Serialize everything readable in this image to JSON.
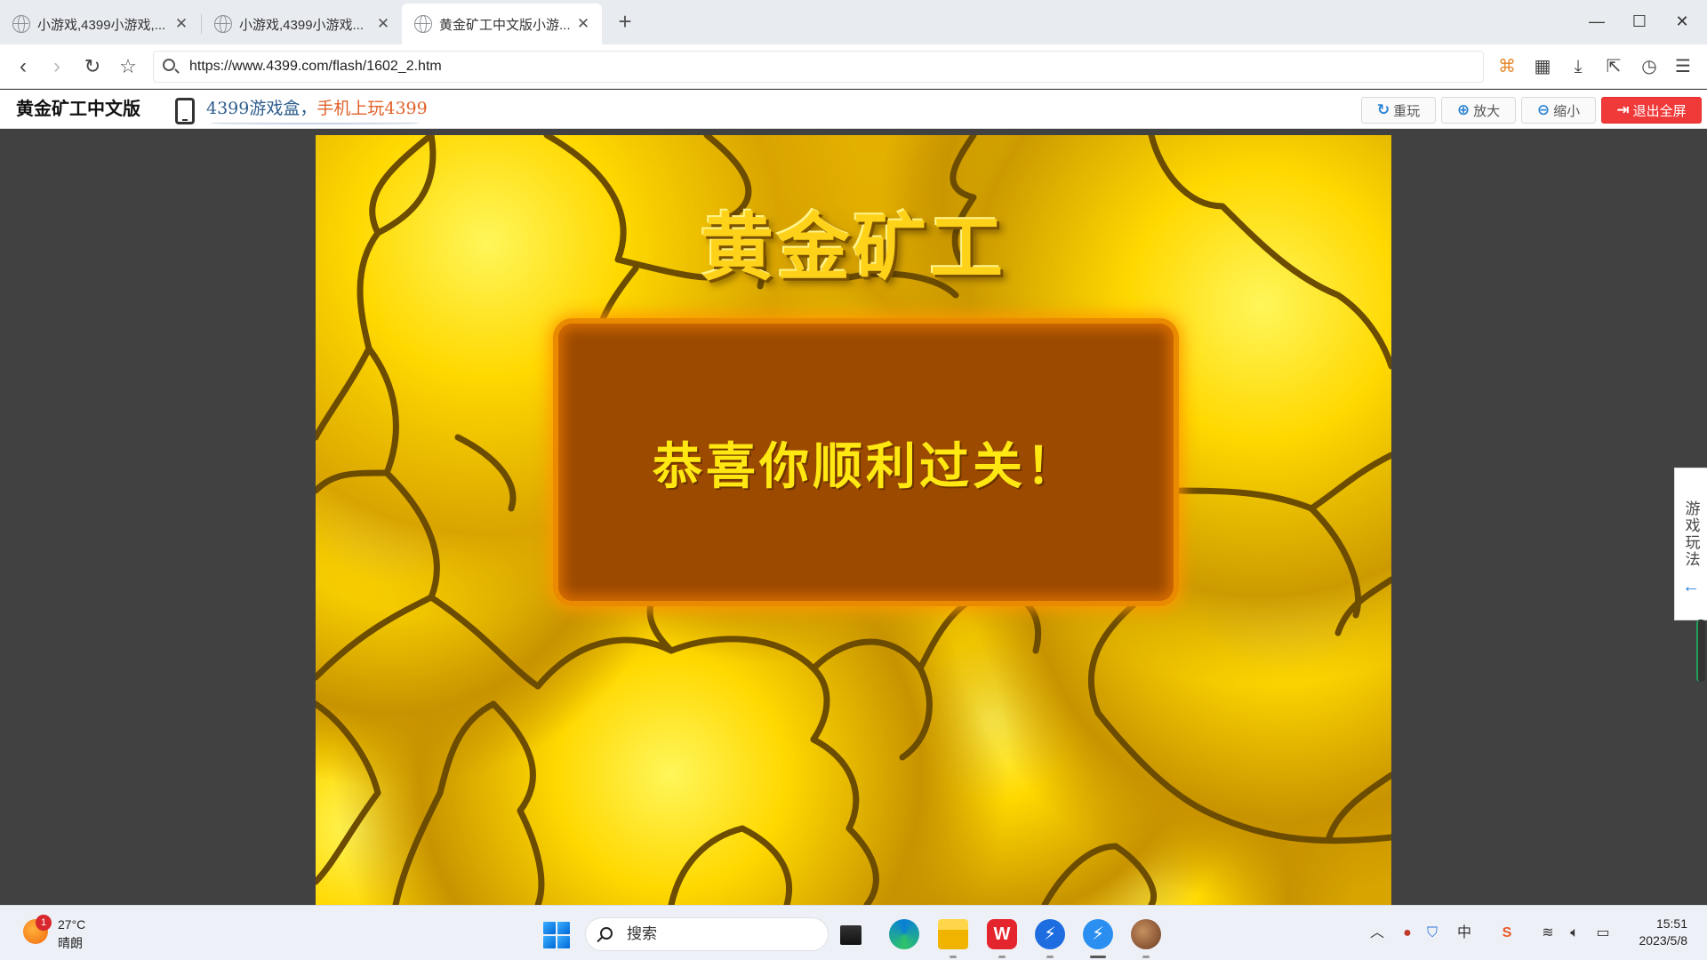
{
  "browser": {
    "tabs": [
      {
        "title": "小游戏,4399小游戏,..."
      },
      {
        "title": "小游戏,4399小游戏..."
      },
      {
        "title": "黄金矿工中文版小游..."
      }
    ],
    "active_tab": 2,
    "new_tab_label": "+",
    "window_controls": {
      "minimize": "—",
      "maximize": "☐",
      "close": "✕"
    },
    "address": {
      "url": "https://www.4399.com/flash/1602_2.htm"
    }
  },
  "gamebar": {
    "title": "黄金矿工中文版",
    "promo_part1": "4399游戏盒，",
    "promo_part2": "手机上玩4399",
    "buttons": {
      "replay": "重玩",
      "zoom_in": "放大",
      "zoom_out": "缩小",
      "exit_fullscreen": "退出全屏"
    }
  },
  "game": {
    "logo": "黄金矿工",
    "message": "恭喜你顺利过关！"
  },
  "sidetab": {
    "label": "游戏玩法",
    "arrow": "←"
  },
  "taskbar": {
    "weather": {
      "temp": "27°C",
      "condition": "晴朗",
      "badge": "1"
    },
    "search_label": "搜索",
    "clock": {
      "time": "15:51",
      "date": "2023/5/8"
    },
    "ime": "中"
  },
  "colors": {
    "accent": "#2a84d6",
    "exit_button": "#f03a3a",
    "panel": "#9c4a00",
    "panel_glow": "#e98a00",
    "message_text": "#ffe812",
    "gold": "#ffd800"
  }
}
